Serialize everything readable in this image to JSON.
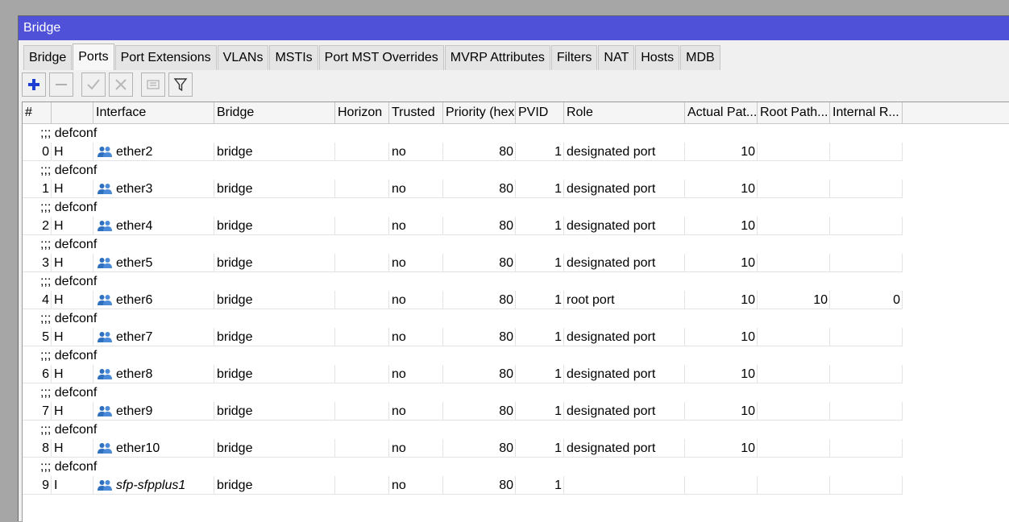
{
  "window": {
    "title": "Bridge"
  },
  "tabs": [
    {
      "label": "Bridge"
    },
    {
      "label": "Ports",
      "active": true
    },
    {
      "label": "Port Extensions"
    },
    {
      "label": "VLANs"
    },
    {
      "label": "MSTIs"
    },
    {
      "label": "Port MST Overrides"
    },
    {
      "label": "MVRP Attributes"
    },
    {
      "label": "Filters"
    },
    {
      "label": "NAT"
    },
    {
      "label": "Hosts"
    },
    {
      "label": "MDB"
    }
  ],
  "toolbar": {
    "buttons": [
      {
        "icon": "plus-icon",
        "color": "#1c3fd1"
      },
      {
        "icon": "minus-icon"
      },
      {
        "icon": "check-icon"
      },
      {
        "icon": "x-icon"
      },
      {
        "icon": "comment-icon"
      },
      {
        "icon": "filter-icon"
      }
    ]
  },
  "table": {
    "columns": [
      "#",
      "",
      "Interface",
      "Bridge",
      "Horizon",
      "Trusted",
      "Priority (hex)",
      "PVID",
      "Role",
      "Actual Pat...",
      "Root Path...",
      "Internal R..."
    ],
    "rows": [
      {
        "comment": ";;; defconf",
        "num": "0",
        "flag": "H",
        "interface": "ether2",
        "bridge": "bridge",
        "horizon": "",
        "trusted": "no",
        "priority": "80",
        "pvid": "1",
        "role": "designated port",
        "actual": "10",
        "root": "",
        "internal": ""
      },
      {
        "comment": ";;; defconf",
        "num": "1",
        "flag": "H",
        "interface": "ether3",
        "bridge": "bridge",
        "horizon": "",
        "trusted": "no",
        "priority": "80",
        "pvid": "1",
        "role": "designated port",
        "actual": "10",
        "root": "",
        "internal": ""
      },
      {
        "comment": ";;; defconf",
        "num": "2",
        "flag": "H",
        "interface": "ether4",
        "bridge": "bridge",
        "horizon": "",
        "trusted": "no",
        "priority": "80",
        "pvid": "1",
        "role": "designated port",
        "actual": "10",
        "root": "",
        "internal": ""
      },
      {
        "comment": ";;; defconf",
        "num": "3",
        "flag": "H",
        "interface": "ether5",
        "bridge": "bridge",
        "horizon": "",
        "trusted": "no",
        "priority": "80",
        "pvid": "1",
        "role": "designated port",
        "actual": "10",
        "root": "",
        "internal": ""
      },
      {
        "comment": ";;; defconf",
        "num": "4",
        "flag": "H",
        "interface": "ether6",
        "bridge": "bridge",
        "horizon": "",
        "trusted": "no",
        "priority": "80",
        "pvid": "1",
        "role": "root port",
        "actual": "10",
        "root": "10",
        "internal": "0"
      },
      {
        "comment": ";;; defconf",
        "num": "5",
        "flag": "H",
        "interface": "ether7",
        "bridge": "bridge",
        "horizon": "",
        "trusted": "no",
        "priority": "80",
        "pvid": "1",
        "role": "designated port",
        "actual": "10",
        "root": "",
        "internal": ""
      },
      {
        "comment": ";;; defconf",
        "num": "6",
        "flag": "H",
        "interface": "ether8",
        "bridge": "bridge",
        "horizon": "",
        "trusted": "no",
        "priority": "80",
        "pvid": "1",
        "role": "designated port",
        "actual": "10",
        "root": "",
        "internal": ""
      },
      {
        "comment": ";;; defconf",
        "num": "7",
        "flag": "H",
        "interface": "ether9",
        "bridge": "bridge",
        "horizon": "",
        "trusted": "no",
        "priority": "80",
        "pvid": "1",
        "role": "designated port",
        "actual": "10",
        "root": "",
        "internal": ""
      },
      {
        "comment": ";;; defconf",
        "num": "8",
        "flag": "H",
        "interface": "ether10",
        "bridge": "bridge",
        "horizon": "",
        "trusted": "no",
        "priority": "80",
        "pvid": "1",
        "role": "designated port",
        "actual": "10",
        "root": "",
        "internal": ""
      },
      {
        "comment": ";;; defconf",
        "num": "9",
        "flag": "I",
        "interface": "sfp-sfpplus1",
        "italic": true,
        "bridge": "bridge",
        "horizon": "",
        "trusted": "no",
        "priority": "80",
        "pvid": "1",
        "role": "",
        "actual": "",
        "root": "",
        "internal": ""
      }
    ]
  }
}
